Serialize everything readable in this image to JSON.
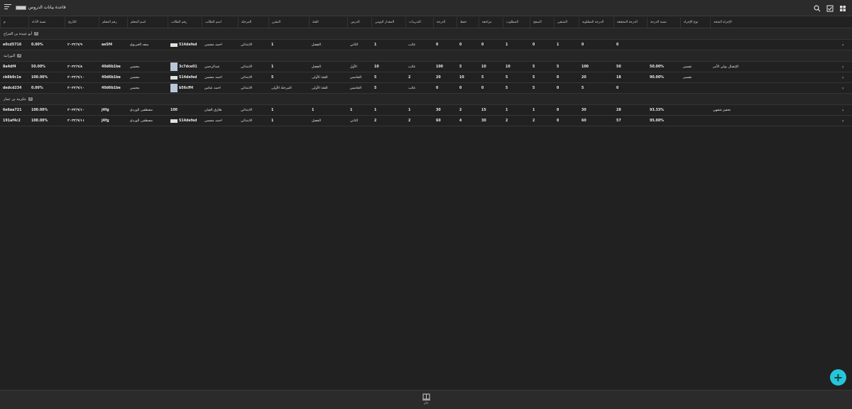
{
  "header": {
    "title": "قاعدة بيانات الدروس"
  },
  "icons": {
    "menu": "menu-icon",
    "search": "search-icon",
    "checklist": "checkbox-icon",
    "grid": "grid-view-icon",
    "add": "plus-icon",
    "nav": "library-icon"
  },
  "columns": {
    "id": "م",
    "rate": "نسبة الأداء",
    "date": "التاريخ",
    "teacher_no": "رقم المعلم",
    "teacher": "اسم المعلم",
    "student_no": "رقم الطالب",
    "student": "اسم الطالب",
    "stage": "المرحلة",
    "level": "المقرر",
    "class": "الفئة",
    "lesson": "الدرس",
    "daily": "المقدار اليومي",
    "assign": "التدريبات",
    "grade": "الدرجة",
    "memorize": "حفظ",
    "review": "مراجعة",
    "required": "المطلوب",
    "pages": "الصفح",
    "completed": "المتبقي",
    "req_grade": "الدرجة المطلوبة",
    "achieved": "الدرجة المحققة",
    "percent": "نسبة الدرجة",
    "proc_type": "نوع الإجراء",
    "proc": "الإجراء المتخذ"
  },
  "groups": [
    {
      "name": "أبو عبيدة بن الجراح",
      "count": "1",
      "rows": [
        {
          "id": "e0cd5716",
          "rate": "0.00%",
          "date": "٢٠٢٢/٩/٩",
          "teacher_no": "ae5f4",
          "teacher": "سعد الحربوي",
          "student_no": "514defed",
          "student": "احمد محسن",
          "stage": "الابتدائي",
          "level": "1",
          "class": "الفصل",
          "lesson": "الثاني",
          "daily": "1",
          "assign": "غائب",
          "grade": "0",
          "memorize": "0",
          "review": "0",
          "required": "1",
          "pages": "0",
          "completed": "1",
          "req_grade": "0",
          "achieved": "0",
          "percent": "",
          "proc_type": "",
          "proc": ""
        }
      ]
    },
    {
      "name": "النورانية",
      "count": "3",
      "rows": [
        {
          "id": "8a4df4",
          "rate": "50.00%",
          "date": "٢٠٢٢/٩/٨",
          "teacher_no": "40d6b1be",
          "teacher": "محسن",
          "student_no": "3c7dce01",
          "student": "عبدالرحمن",
          "stage": "الابتدائي",
          "level": "1",
          "class": "الفصل",
          "lesson": "الأول",
          "daily": "10",
          "assign": "غائب",
          "grade": "100",
          "memorize": "5",
          "review": "10",
          "required": "10",
          "pages": "5",
          "completed": "5",
          "req_grade": "100",
          "achieved": "50",
          "percent": "50.00%",
          "proc_type": "تفسير",
          "proc": "الإتصال بولي الأمر"
        },
        {
          "id": "cb8b9c1e",
          "rate": "100.00%",
          "date": "٢٠٢٢/٩/١٠",
          "teacher_no": "40d6b1be",
          "teacher": "محسن",
          "student_no": "514defed",
          "student": "احمد محسن",
          "stage": "الابتدائي",
          "level": "5",
          "class": "الفئة الأولى",
          "lesson": "الخامس",
          "daily": "5",
          "assign": "2",
          "grade": "20",
          "memorize": "10",
          "review": "5",
          "required": "5",
          "pages": "5",
          "completed": "0",
          "req_grade": "20",
          "achieved": "18",
          "percent": "90.00%",
          "proc_type": "تفسير",
          "proc": ""
        },
        {
          "id": "dedcd234",
          "rate": "0.00%",
          "date": "٢٠٢٢/٩/١٠",
          "teacher_no": "40d6b1be",
          "teacher": "محسن",
          "student_no": "b56cff4",
          "student": "احمد عباس",
          "stage": "الابتدائي",
          "level": "المرحلة الأولى",
          "class": "الفئة الأولى",
          "lesson": "الخامس",
          "daily": "5",
          "assign": "غائب",
          "grade": "0",
          "memorize": "0",
          "review": "0",
          "required": "5",
          "pages": "5",
          "completed": "0",
          "req_grade": "5",
          "achieved": "0",
          "percent": "",
          "proc_type": "",
          "proc": ""
        }
      ]
    },
    {
      "name": "عكرمة بن عمار",
      "count": "2",
      "rows": [
        {
          "id": "6e6aa721",
          "rate": "100.00%",
          "date": "٢٠٢٢/٩/١٠",
          "teacher_no": "j4fg",
          "teacher": "مصطفى الوردي",
          "student_no": "100",
          "student": "طارق العيان",
          "stage": "الابتدائي",
          "level": "1",
          "class": "1",
          "lesson": "1",
          "daily": "1",
          "assign": "1",
          "grade": "30",
          "memorize": "2",
          "review": "15",
          "required": "1",
          "pages": "1",
          "completed": "0",
          "req_grade": "30",
          "achieved": "28",
          "percent": "93.33%",
          "proc_type": "",
          "proc": "تحفيز شفهي"
        },
        {
          "id": "191af4c2",
          "rate": "100.00%",
          "date": "٢٠٢٢/٩/١١",
          "teacher_no": "j4fg",
          "teacher": "مصطفى الوردي",
          "student_no": "514defed",
          "student": "احمد محسن",
          "stage": "الابتدائي",
          "level": "1",
          "class": "الفصل",
          "lesson": "الثاني",
          "daily": "2",
          "assign": "2",
          "grade": "60",
          "memorize": "4",
          "review": "30",
          "required": "2",
          "pages": "2",
          "completed": "0",
          "req_grade": "60",
          "achieved": "57",
          "percent": "95.00%",
          "proc_type": "",
          "proc": ""
        }
      ]
    }
  ],
  "bottom_nav": {
    "label": "الأم"
  }
}
